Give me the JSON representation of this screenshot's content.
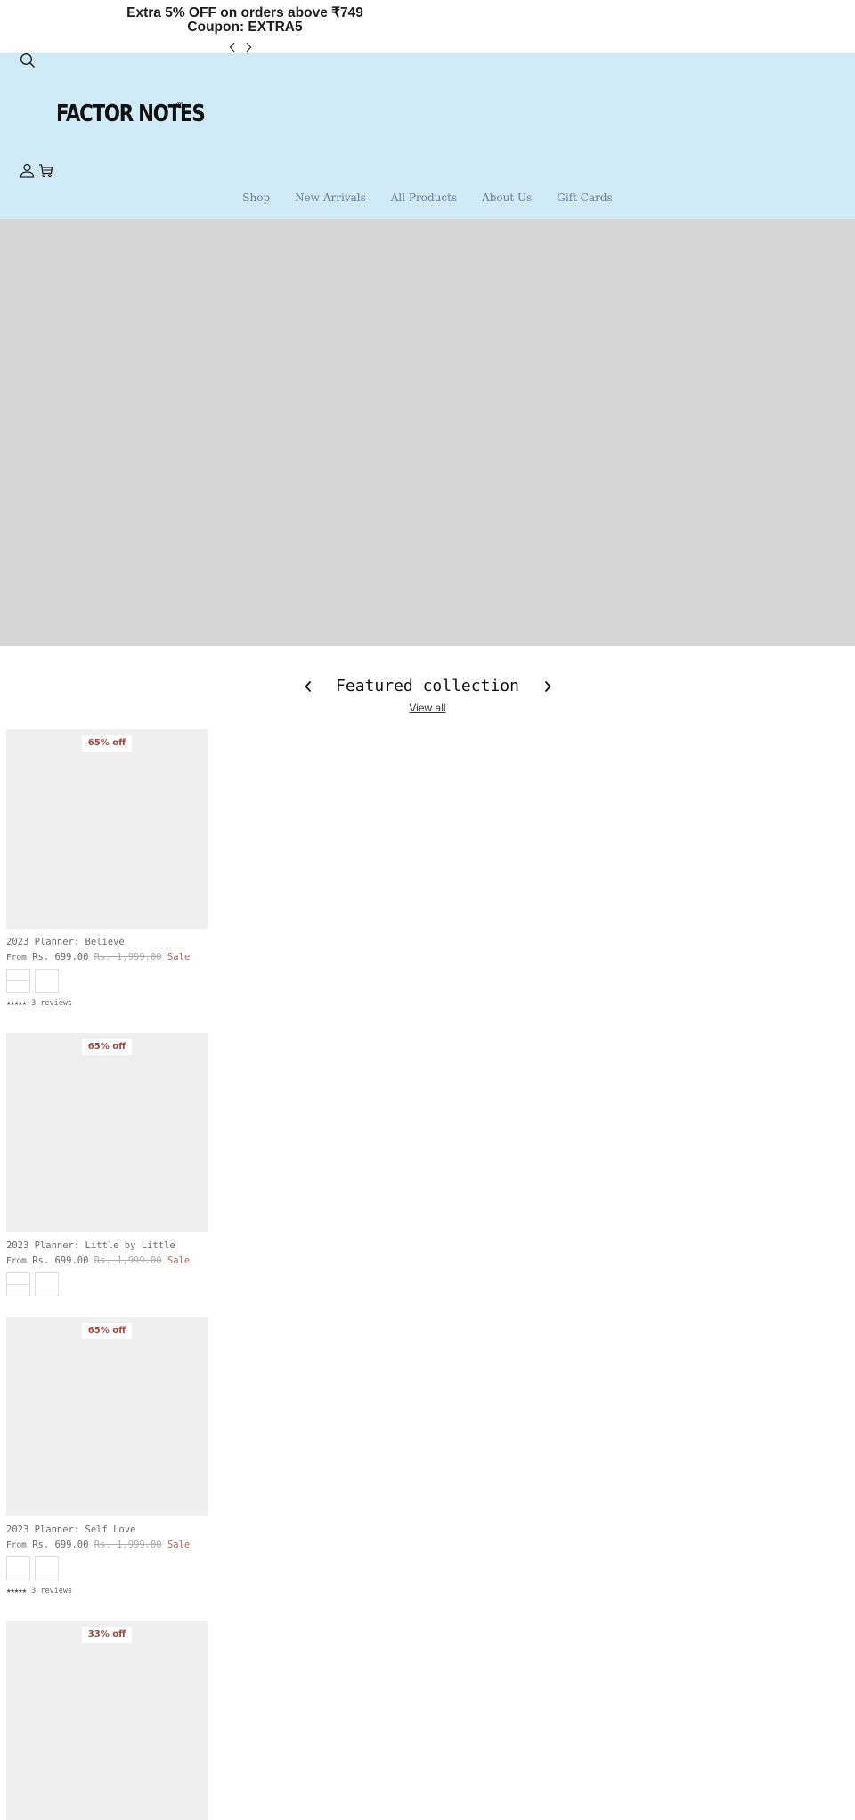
{
  "announcement": {
    "line1": "Extra 5% OFF on orders above ₹749",
    "line2": "Coupon: EXTRA5"
  },
  "header": {
    "logo_text": "FACTOR NOTES",
    "logo_mark": "®",
    "background": "#d1eaf8",
    "nav": [
      {
        "label": "Shop"
      },
      {
        "label": "New Arrivals"
      },
      {
        "label": "All Products"
      },
      {
        "label": "About Us"
      },
      {
        "label": "Gift Cards"
      }
    ]
  },
  "featured": {
    "title": "Featured collection",
    "view_all": "View all",
    "products": [
      {
        "badge": "65% off",
        "title": "2023 Planner: Believe",
        "from": "From",
        "price": "Rs. 699.00",
        "compare_price": "Rs. 1,999.00",
        "sale": "Sale",
        "swatches": [
          "split",
          "plain"
        ],
        "stars": "★★★★★",
        "reviews": "3 reviews"
      },
      {
        "badge": "65% off",
        "title": "2023 Planner: Little by Little",
        "from": "From",
        "price": "Rs. 699.00",
        "compare_price": "Rs. 1,999.00",
        "sale": "Sale",
        "swatches": [
          "split",
          "plain"
        ]
      },
      {
        "badge": "65% off",
        "title": "2023 Planner: Self Love",
        "from": "From",
        "price": "Rs. 699.00",
        "compare_price": "Rs. 1,999.00",
        "sale": "Sale",
        "swatches": [
          "plain",
          "plain"
        ],
        "stars": "★★★★★",
        "reviews": "3 reviews"
      },
      {
        "badge": "33% off"
      }
    ]
  }
}
